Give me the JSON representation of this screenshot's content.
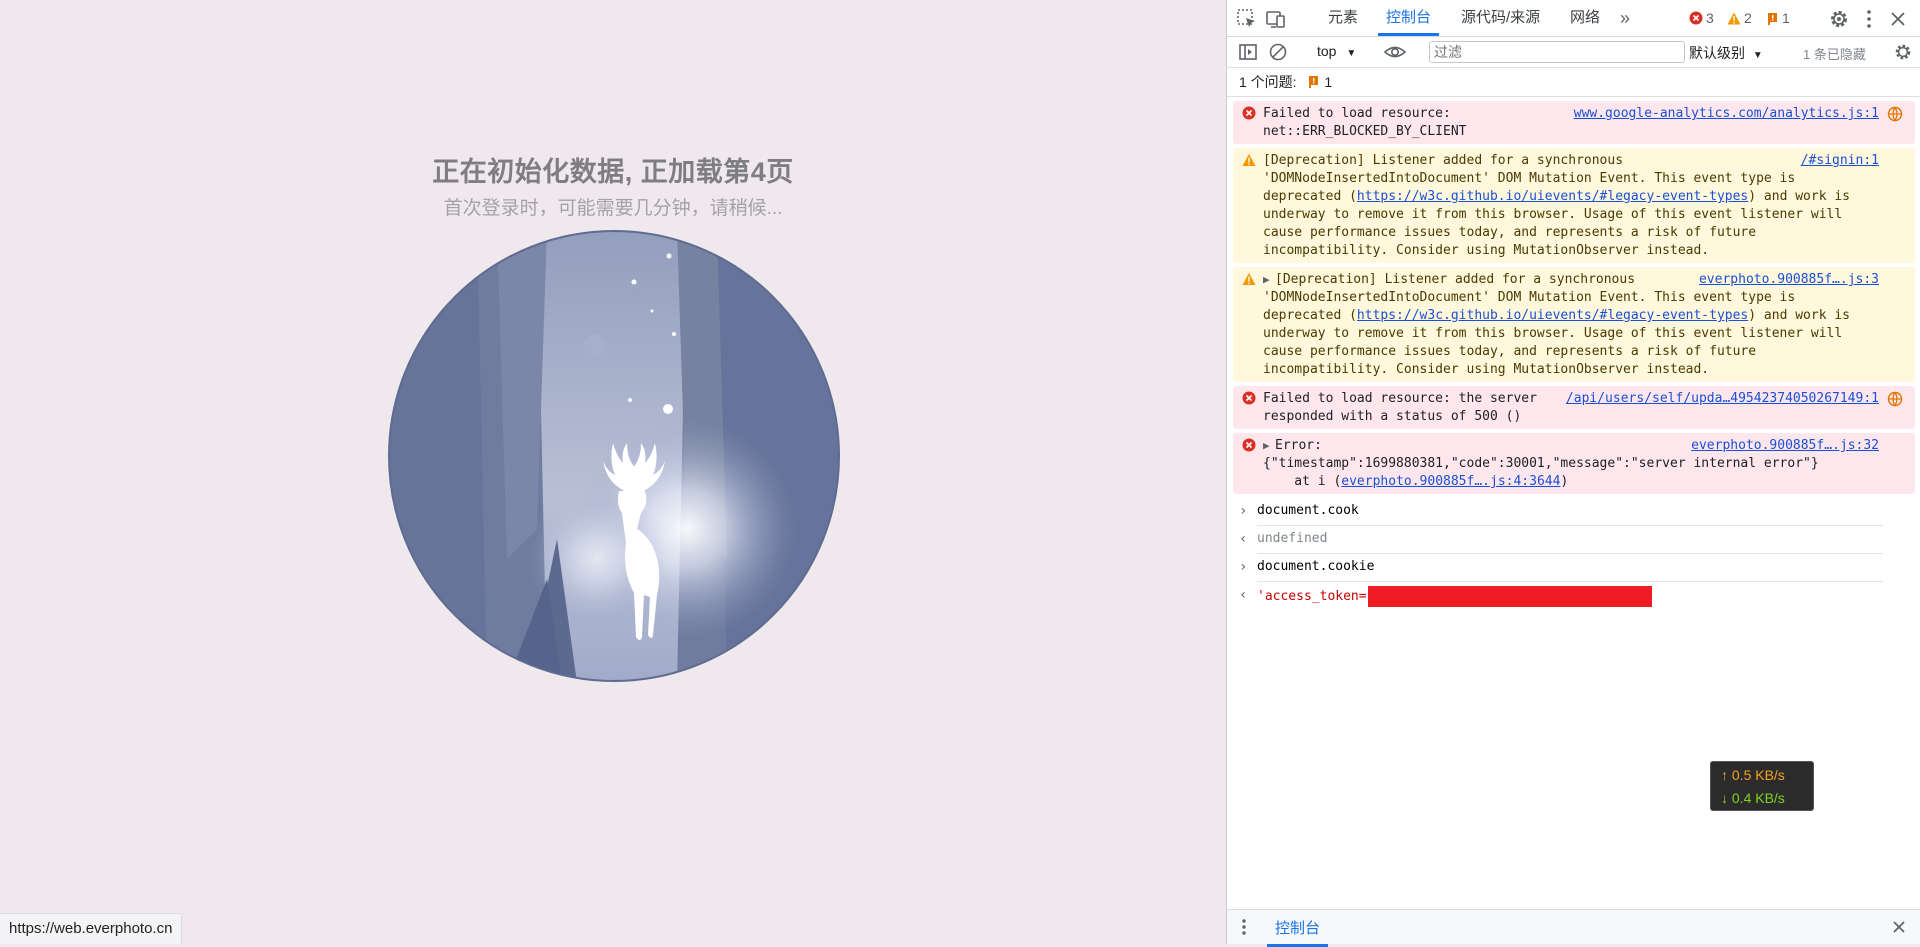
{
  "page": {
    "loading_title": "正在初始化数据, 正加载第4页",
    "loading_subtitle": "首次登录时，可能需要几分钟，请稍候...",
    "status_url": "https://web.everphoto.cn"
  },
  "devtools": {
    "tabs": [
      {
        "label": "元素",
        "active": false
      },
      {
        "label": "控制台",
        "active": true
      },
      {
        "label": "源代码/来源",
        "active": false
      },
      {
        "label": "网络",
        "active": false
      }
    ],
    "badges": {
      "errors": "3",
      "warnings": "2",
      "issues": "1"
    },
    "toolbar": {
      "context": "top",
      "filter_placeholder": "过滤",
      "level": "默认级别",
      "hidden": "1 条已隐藏"
    },
    "issues_bar": {
      "label": "1 个问题:",
      "count": "1"
    },
    "messages": [
      {
        "type": "error",
        "text": "Failed to load resource: net::ERR_BLOCKED_BY_CLIENT",
        "source": "www.google-analytics.com/analytics.js:1"
      },
      {
        "type": "warn",
        "text_before": "[Deprecation] Listener added for a synchronous 'DOMNodeInsertedIntoDocument' DOM Mutation Event. This event type is deprecated (",
        "link": "https://w3c.github.io/uievents/#legacy-event-types",
        "text_after": ") and work is underway to remove it from this browser. Usage of this event listener will cause performance issues today, and represents a risk of future incompatibility. Consider using MutationObserver instead.",
        "source": "/#signin:1"
      },
      {
        "type": "warn",
        "text_before": "[Deprecation] Listener added for a synchronous 'DOMNodeInsertedIntoDocument' DOM Mutation Event. This event type is deprecated (",
        "link": "https://w3c.github.io/uievents/#legacy-event-types",
        "text_after": ") and work is underway to remove it from this browser. Usage of this event listener will cause performance issues today, and represents a risk of future incompatibility. Consider using MutationObserver instead.",
        "source": "everphoto.900885f….js:3"
      },
      {
        "type": "error",
        "text": "Failed to load resource: the server responded with a status of 500 ()",
        "source": "/api/users/self/upda…495423740502671​49:1"
      },
      {
        "type": "error",
        "line1": "Error:",
        "line2": "{\"timestamp\":1699880381,\"code\":30001,\"message\":\"server internal error\"}",
        "line3_prefix": "    at i (",
        "line3_link": "everphoto.900885f….js:4:3644",
        "line3_suffix": ")",
        "source": "everphoto.900885f….js:32"
      }
    ],
    "repl": [
      {
        "kind": "input",
        "text": "document.cook"
      },
      {
        "kind": "output",
        "text": "undefined"
      },
      {
        "kind": "input",
        "text": "document.cookie"
      },
      {
        "kind": "output",
        "text": "'access_token="
      }
    ],
    "network_overlay": {
      "up": "0.5 KB/s",
      "down": "0.4 KB/s"
    },
    "drawer": {
      "tab": "控制台"
    }
  }
}
